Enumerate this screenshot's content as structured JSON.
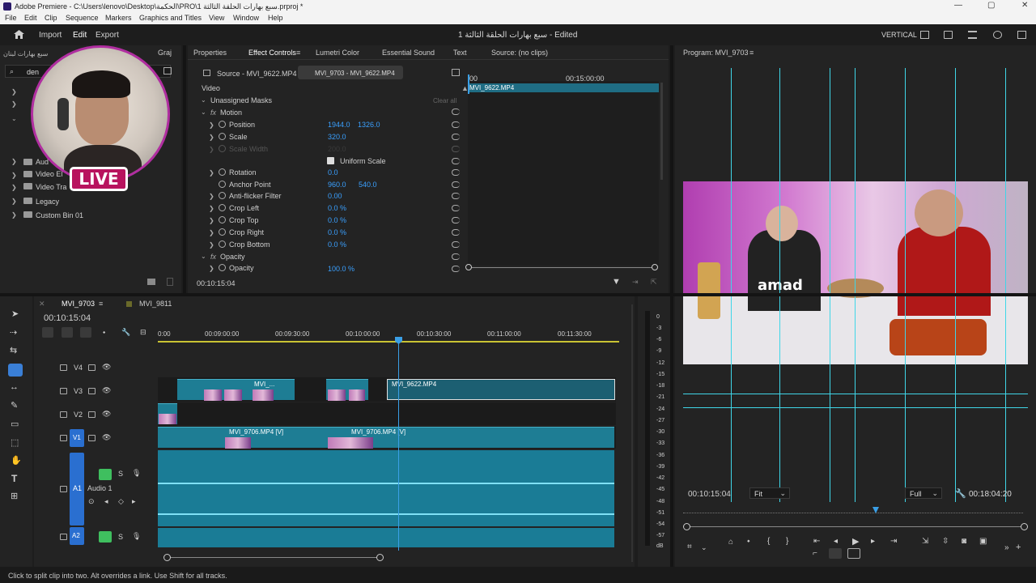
{
  "titlebar": {
    "title": "Adobe Premiere - C:\\Users\\lenovo\\Desktop\\الحكمة\\PRO\\1 سبع بهارات الحلقة الثالثة.prproj *",
    "min": "—",
    "max": "▢",
    "close": "✕"
  },
  "menu": [
    "File",
    "Edit",
    "Clip",
    "Sequence",
    "Markers",
    "Graphics and Titles",
    "View",
    "Window",
    "Help"
  ],
  "header": {
    "tabs": [
      "Import",
      "Edit",
      "Export"
    ],
    "active_tab": "Edit",
    "doc_title": "1 سبع بهارات الحلقة الثالثة - Edited",
    "workspace": "VERTICAL"
  },
  "project": {
    "tabs": [
      "Graj"
    ],
    "bin_name": "سبع بهارات لبنان",
    "search_value": "den",
    "items": [
      {
        "label": "Aud"
      },
      {
        "label": "Video El"
      },
      {
        "label": "Video Tra"
      },
      {
        "label": "Legacy"
      },
      {
        "label": "Custom Bin 01"
      }
    ],
    "live_badge": "LIVE"
  },
  "effect_controls": {
    "tabs": [
      "Properties",
      "Effect Controls",
      "Lumetri Color",
      "Essential Sound",
      "Text",
      "Source: (no clips)"
    ],
    "active_tab": "Effect Controls",
    "source_label": "Source - MVI_9622.MP4",
    "seq_label": "MVI_9703 - MVI_9622.MP4",
    "section_video": "Video",
    "unassigned_masks": "Unassigned Masks",
    "clear_all": "Clear all",
    "motion": "Motion",
    "fx": "fx",
    "properties": [
      {
        "name": "Position",
        "v1": "1944.0",
        "v2": "1326.0"
      },
      {
        "name": "Scale",
        "v1": "320.0",
        "v2": ""
      },
      {
        "name": "Scale Width",
        "v1": "200.0",
        "v2": ""
      },
      {
        "name": "Uniform Scale",
        "v1": "",
        "v2": ""
      },
      {
        "name": "Rotation",
        "v1": "0.0",
        "v2": ""
      },
      {
        "name": "Anchor Point",
        "v1": "960.0",
        "v2": "540.0"
      },
      {
        "name": "Anti-flicker Filter",
        "v1": "0.00",
        "v2": ""
      },
      {
        "name": "Crop Left",
        "v1": "0.0 %",
        "v2": ""
      },
      {
        "name": "Crop Top",
        "v1": "0.0 %",
        "v2": ""
      },
      {
        "name": "Crop Right",
        "v1": "0.0 %",
        "v2": ""
      },
      {
        "name": "Crop Bottom",
        "v1": "0.0 %",
        "v2": ""
      },
      {
        "name": "Opacity",
        "v1": "",
        "v2": ""
      },
      {
        "name": "Opacity",
        "v1": "100.0 %",
        "v2": ""
      }
    ],
    "mini_timecode_left": "00",
    "mini_timecode_right": "00:15:00:00",
    "mini_clip": "MVI_9622.MP4",
    "timecode": "00:10:15:04"
  },
  "program": {
    "title": "Program: MVI_9703",
    "timecode": "00:10:15:04",
    "fit": "Fit",
    "quality": "Full",
    "duration": "00:18:04:20"
  },
  "timeline": {
    "tabs": [
      "MVI_9703",
      "MVI_9811"
    ],
    "timecode": "00:10:15:04",
    "ruler": [
      "0:00",
      "00:09:00:00",
      "00:09:30:00",
      "00:10:00:00",
      "00:10:30:00",
      "00:11:00:00",
      "00:11:30:00"
    ],
    "tracks": [
      {
        "id": "V4"
      },
      {
        "id": "V3"
      },
      {
        "id": "V2"
      },
      {
        "id": "V1"
      },
      {
        "id": "A1",
        "name": "Audio 1"
      },
      {
        "id": "A2"
      }
    ],
    "clips": {
      "v3_a": "MVI_...",
      "v3_b": "MVI_9622.MP4",
      "v1_a": "MVI_9706.MP4 [V]",
      "v1_b": "MVI_9706.MP4 [V]"
    }
  },
  "meter": {
    "ticks": [
      "0",
      "-3",
      "-6",
      "-9",
      "-12",
      "-15",
      "-18",
      "-21",
      "-24",
      "-27",
      "-30",
      "-33",
      "-36",
      "-39",
      "-42",
      "-45",
      "-48",
      "-51",
      "-54",
      "-57",
      "dB"
    ]
  },
  "status": "Click to split clip into two. Alt overrides a link. Use Shift for all tracks.",
  "colors": {
    "accent": "#3a9fe6",
    "clip": "#1e7d94",
    "playhead": "#3a9fe6",
    "guide": "#3fd6e8"
  }
}
